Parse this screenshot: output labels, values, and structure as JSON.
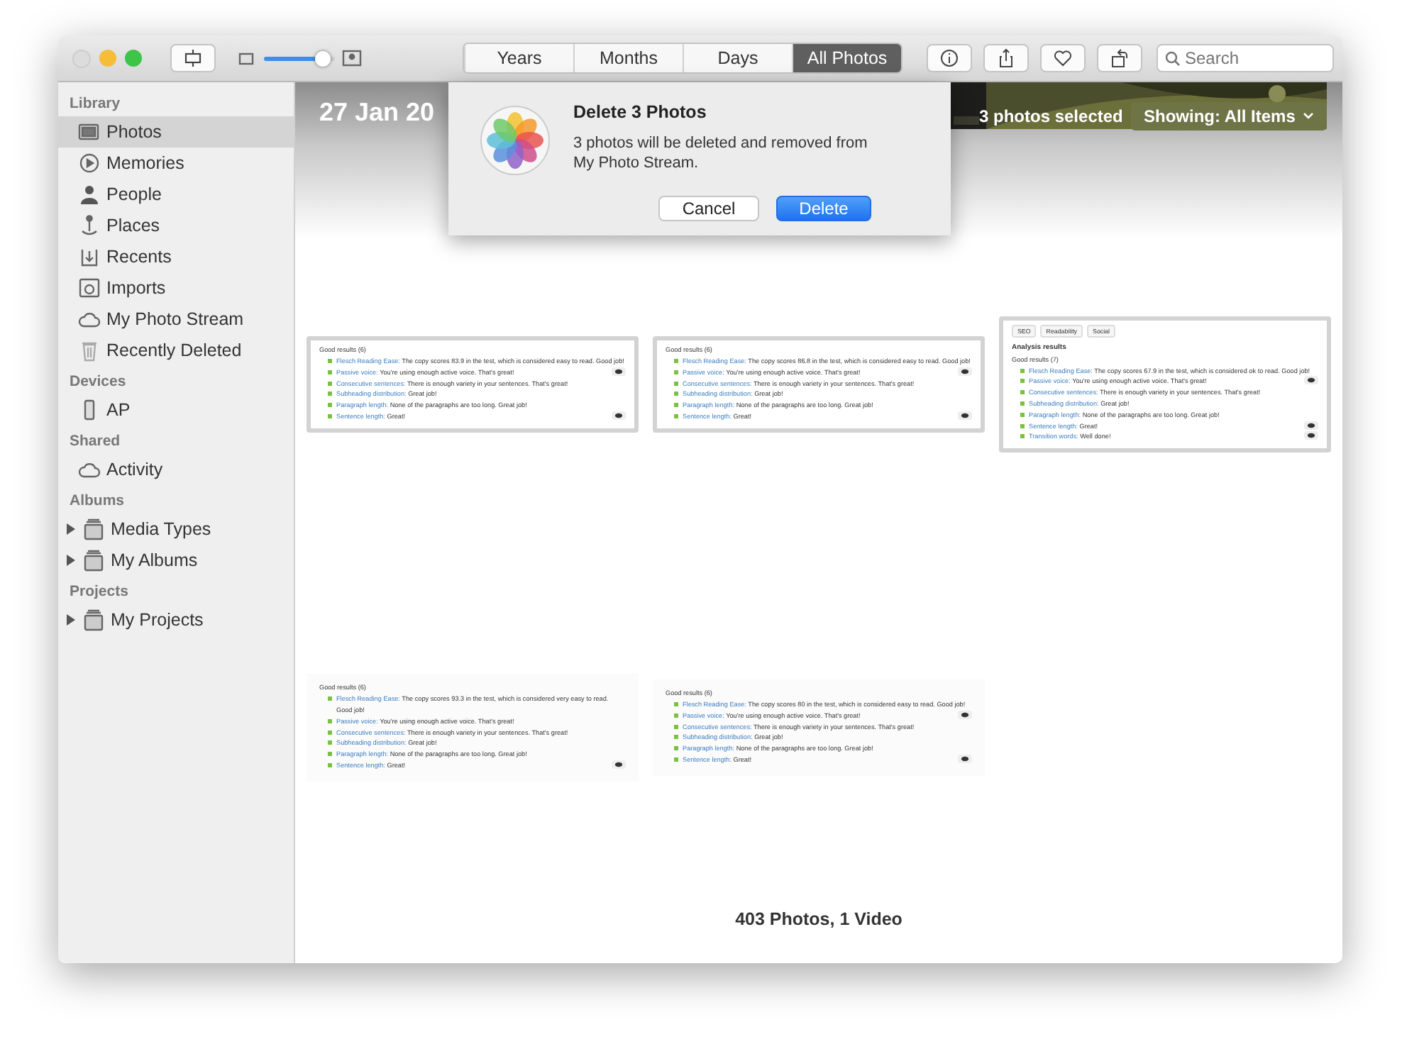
{
  "toolbar": {
    "views": [
      {
        "label": "Years",
        "selected": false
      },
      {
        "label": "Months",
        "selected": false
      },
      {
        "label": "Days",
        "selected": false
      },
      {
        "label": "All Photos",
        "selected": true
      }
    ],
    "zoom": {
      "level": 0.82
    },
    "search": {
      "placeholder": "Search"
    }
  },
  "sidebar": {
    "sections": [
      {
        "title": "Library",
        "items": [
          {
            "label": "Photos",
            "selected": true
          },
          {
            "label": "Memories",
            "selected": false
          },
          {
            "label": "People",
            "selected": false
          },
          {
            "label": "Places",
            "selected": false
          },
          {
            "label": "Recents",
            "selected": false
          },
          {
            "label": "Imports",
            "selected": false
          },
          {
            "label": "My Photo Stream",
            "selected": false
          },
          {
            "label": "Recently Deleted",
            "selected": false
          }
        ]
      },
      {
        "title": "Devices",
        "items": [
          {
            "label": "AP",
            "selected": false
          }
        ]
      },
      {
        "title": "Shared",
        "items": [
          {
            "label": "Activity",
            "selected": false
          }
        ]
      },
      {
        "title": "Albums",
        "items": [
          {
            "label": "Media Types",
            "selected": false,
            "expanded": false
          },
          {
            "label": "My Albums",
            "selected": false,
            "expanded": false
          }
        ]
      },
      {
        "title": "Projects",
        "items": [
          {
            "label": "My Projects",
            "selected": false,
            "expanded": false
          }
        ]
      }
    ]
  },
  "header": {
    "date": "27 Jan 20",
    "selection": "3 photos selected",
    "filter": "Showing: All Items"
  },
  "photos": [
    {
      "selected": true,
      "heading": "Good results (6)",
      "items": [
        {
          "label": "Flesch Reading Ease:",
          "text": "The copy scores 83.9 in the test, which is considered easy to read. Good job!",
          "eye": false
        },
        {
          "label": "Passive voice:",
          "text": "You're using enough active voice. That's great!",
          "eye": true
        },
        {
          "label": "Consecutive sentences:",
          "text": "There is enough variety in your sentences. That's great!",
          "eye": false
        },
        {
          "label": "Subheading distribution:",
          "text": "Great job!",
          "eye": false
        },
        {
          "label": "Paragraph length:",
          "text": "None of the paragraphs are too long. Great job!",
          "eye": false
        },
        {
          "label": "Sentence length:",
          "text": "Great!",
          "eye": true
        }
      ]
    },
    {
      "selected": true,
      "heading": "Good results (6)",
      "items": [
        {
          "label": "Flesch Reading Ease:",
          "text": "The copy scores 86.8 in the test, which is considered easy to read. Good job!",
          "eye": false
        },
        {
          "label": "Passive voice:",
          "text": "You're using enough active voice. That's great!",
          "eye": true
        },
        {
          "label": "Consecutive sentences:",
          "text": "There is enough variety in your sentences. That's great!",
          "eye": false
        },
        {
          "label": "Subheading distribution:",
          "text": "Great job!",
          "eye": false
        },
        {
          "label": "Paragraph length:",
          "text": "None of the paragraphs are too long. Great job!",
          "eye": false
        },
        {
          "label": "Sentence length:",
          "text": "Great!",
          "eye": true
        }
      ]
    },
    {
      "selected": true,
      "tabs": [
        "SEO",
        "Readability",
        "Social"
      ],
      "title": "Analysis results",
      "heading": "Good results (7)",
      "items": [
        {
          "label": "Flesch Reading Ease:",
          "text": "The copy scores 67.9 in the test, which is considered ok to read. Good job!",
          "eye": false
        },
        {
          "label": "Passive voice:",
          "text": "You're using enough active voice. That's great!",
          "eye": true
        },
        {
          "label": "Consecutive sentences:",
          "text": "There is enough variety in your sentences. That's great!",
          "eye": false
        },
        {
          "label": "Subheading distribution:",
          "text": "Great job!",
          "eye": false
        },
        {
          "label": "Paragraph length:",
          "text": "None of the paragraphs are too long. Great job!",
          "eye": false
        },
        {
          "label": "Sentence length:",
          "text": "Great!",
          "eye": true
        },
        {
          "label": "Transition words:",
          "text": "Well done!",
          "eye": true
        }
      ]
    },
    {
      "selected": false,
      "heading": "Good results (6)",
      "items": [
        {
          "label": "Flesch Reading Ease:",
          "text": "The copy scores 93.3 in the test, which is considered very easy to read. Good job!",
          "eye": false
        },
        {
          "label": "Passive voice:",
          "text": "You're using enough active voice. That's great!",
          "eye": false
        },
        {
          "label": "Consecutive sentences:",
          "text": "There is enough variety in your sentences. That's great!",
          "eye": false
        },
        {
          "label": "Subheading distribution:",
          "text": "Great job!",
          "eye": false
        },
        {
          "label": "Paragraph length:",
          "text": "None of the paragraphs are too long. Great job!",
          "eye": false
        },
        {
          "label": "Sentence length:",
          "text": "Great!",
          "eye": true
        }
      ]
    },
    {
      "selected": false,
      "heading": "Good results (6)",
      "items": [
        {
          "label": "Flesch Reading Ease:",
          "text": "The copy scores 80 in the test, which is considered easy to read. Good job!",
          "eye": false
        },
        {
          "label": "Passive voice:",
          "text": "You're using enough active voice. That's great!",
          "eye": true
        },
        {
          "label": "Consecutive sentences:",
          "text": "There is enough variety in your sentences. That's great!",
          "eye": false
        },
        {
          "label": "Subheading distribution:",
          "text": "Great job!",
          "eye": false
        },
        {
          "label": "Paragraph length:",
          "text": "None of the paragraphs are too long. Great job!",
          "eye": false
        },
        {
          "label": "Sentence length:",
          "text": "Great!",
          "eye": true
        }
      ]
    }
  ],
  "footer": "403 Photos, 1 Video",
  "dialog": {
    "title": "Delete 3 Photos",
    "message": "3 photos will be deleted and removed from My Photo Stream.",
    "buttons": [
      {
        "label": "Cancel",
        "default": false
      },
      {
        "label": "Delete",
        "default": true
      }
    ]
  }
}
